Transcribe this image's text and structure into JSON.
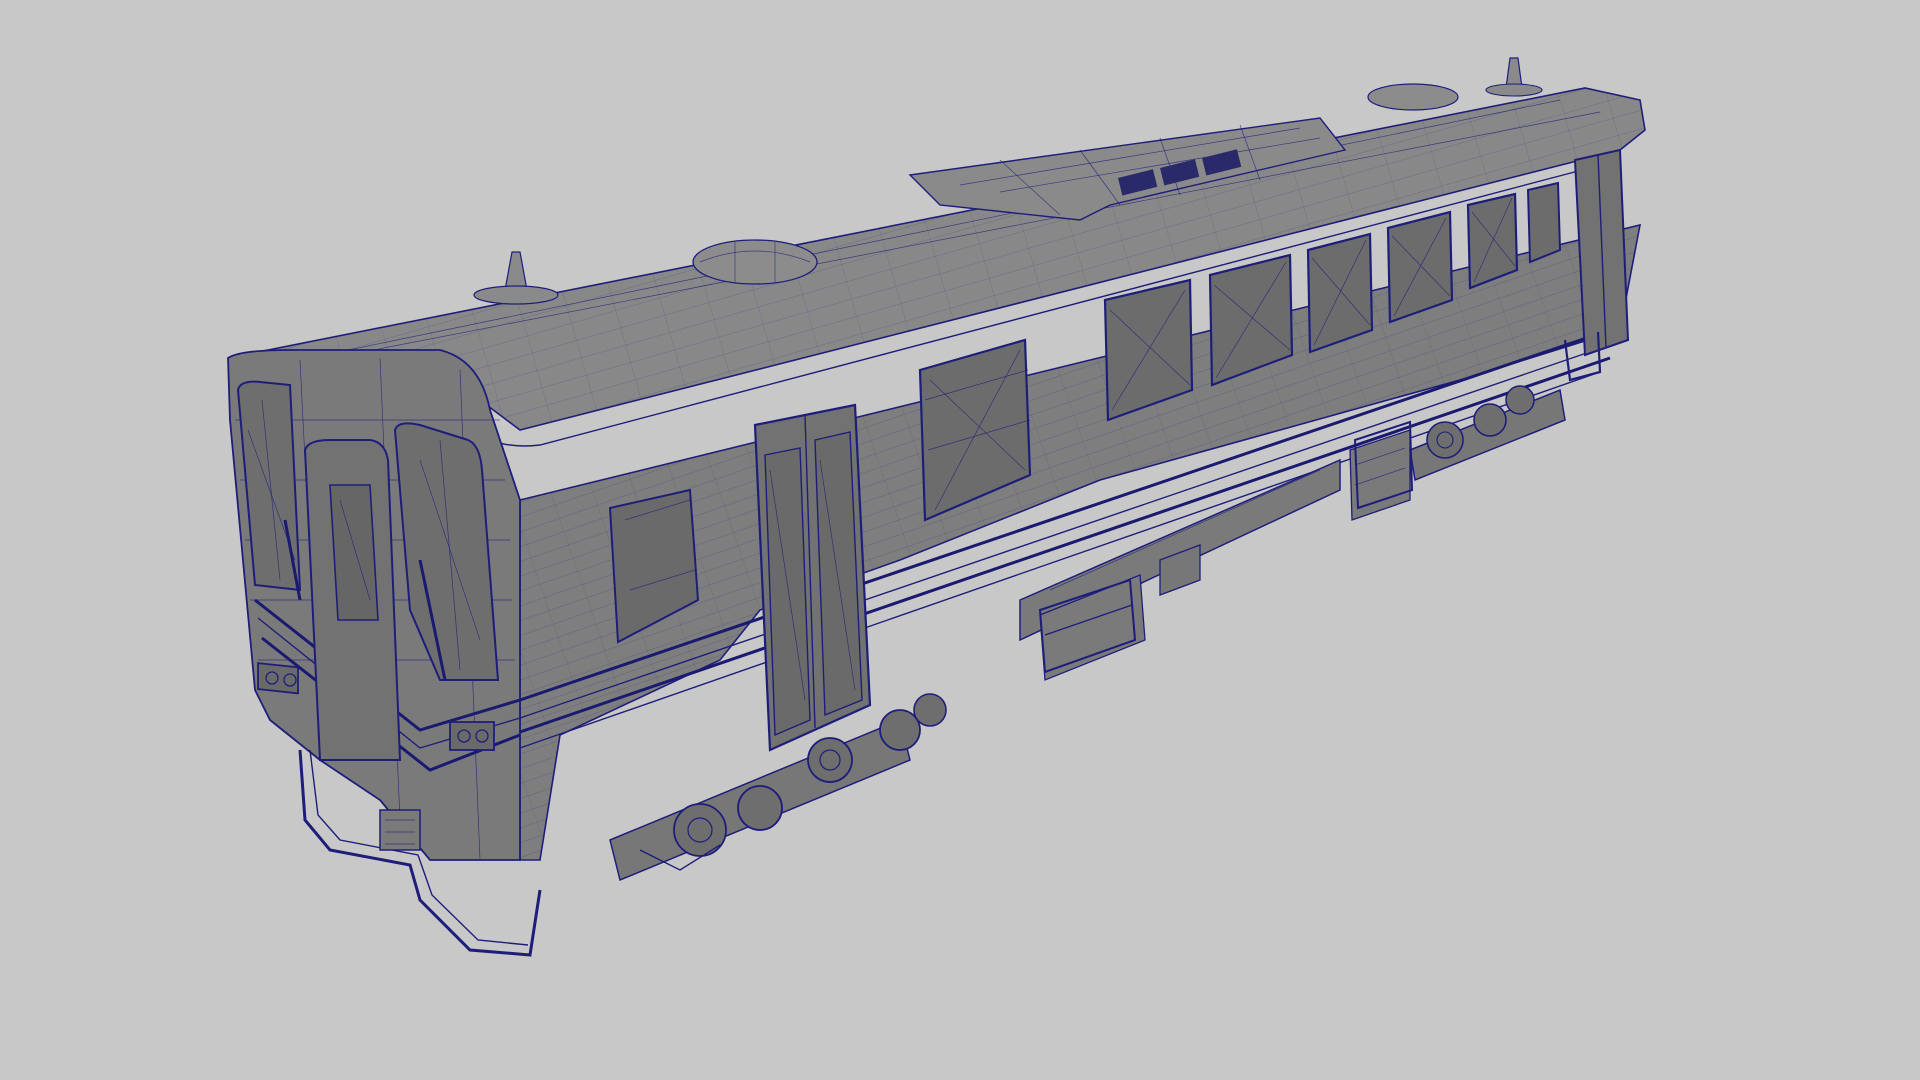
{
  "viewport": {
    "background_color": "#c8c8c8",
    "wire_color": "#1e1e7a",
    "surface_color": "#7e7e7e",
    "shade_color": "#6c6c6c",
    "roof_color": "#888888"
  },
  "scene": {
    "object": "railcar-wireframe-model",
    "view": "perspective"
  }
}
